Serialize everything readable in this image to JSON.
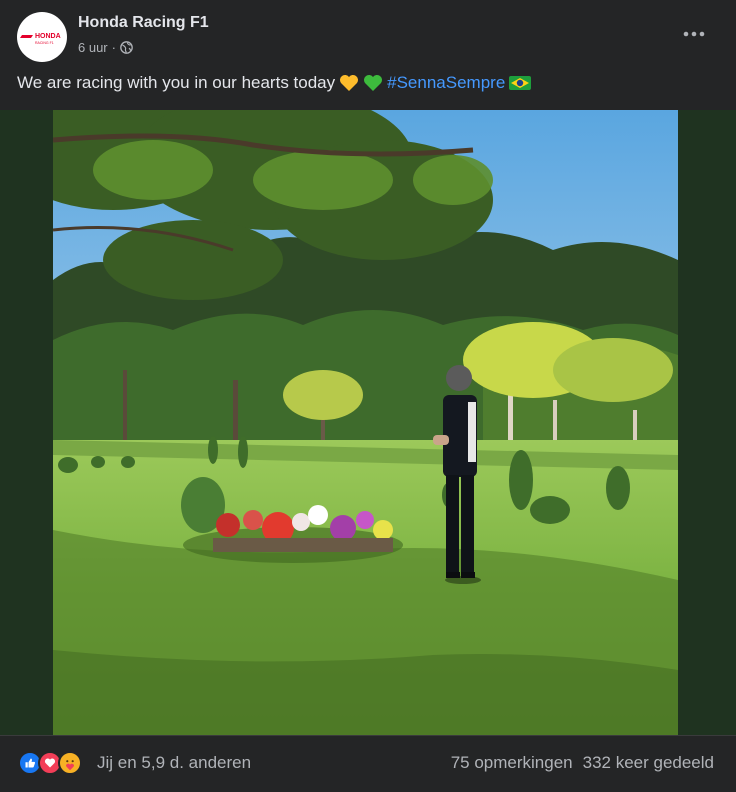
{
  "post": {
    "page_name": "Honda Racing F1",
    "time": "6 uur",
    "separator": "·",
    "privacy_icon": "globe-icon",
    "text": "We are racing with you in our hearts today",
    "emojis": [
      "yellow-heart-icon",
      "green-heart-icon"
    ],
    "hashtag": "#SennaSempre",
    "flag_icon": "brazil-flag-icon"
  },
  "avatar": {
    "logo_text": "HONDA",
    "logo_sub": "RACING F1",
    "logo_color": "#e4002b"
  },
  "footer": {
    "reactions": [
      "like-icon",
      "love-icon",
      "care-icon"
    ],
    "reactions_text": "Jij en 5,9 d. anderen",
    "comments": "75 opmerkingen",
    "shares": "332 keer gedeeld"
  },
  "colors": {
    "background": "#242526",
    "hashtag": "#4599ff",
    "like": "#1877f2",
    "love": "#f33e58",
    "care": "#f7b125"
  }
}
